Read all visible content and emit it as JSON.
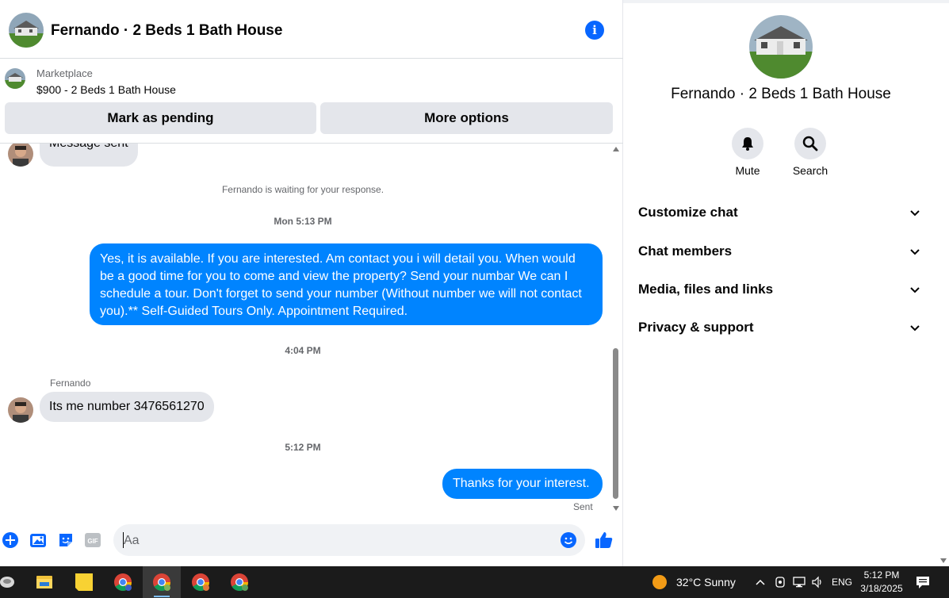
{
  "header": {
    "title": "Fernando · 2 Beds 1 Bath House"
  },
  "marketplace": {
    "label": "Marketplace",
    "listing": "$900 - 2 Beds 1 Bath House",
    "pending_label": "Mark as pending",
    "more_label": "More options"
  },
  "messages": {
    "partial_text": "Message sent",
    "waiting_note": "Fernando is waiting for your response.",
    "time1": "Mon 5:13 PM",
    "outgoing1": "Yes, it is available. If you are interested.  Am contact you i will detail you.  When would be a good time for you to come and view the property? Send your numbar We can I schedule a tour.  Don't forget to send your number (Without number we will not contact you).** Self-Guided Tours Only. Appointment Required.",
    "time2": "4:04 PM",
    "sender": "Fernando",
    "incoming1": "Its me number  3476561270",
    "time3": "5:12 PM",
    "outgoing2": "Thanks for your interest.",
    "sent_status": "Sent"
  },
  "composer": {
    "placeholder": "Aa"
  },
  "details": {
    "title": "Fernando · 2 Beds 1 Bath House",
    "mute_label": "Mute",
    "search_label": "Search",
    "sections": [
      {
        "label": "Customize chat"
      },
      {
        "label": "Chat members"
      },
      {
        "label": "Media, files and links"
      },
      {
        "label": "Privacy & support"
      }
    ]
  },
  "taskbar": {
    "weather": "32°C  Sunny",
    "lang": "ENG",
    "time": "5:12 PM",
    "date": "3/18/2025"
  },
  "colors": {
    "accent": "#0084ff",
    "brand_blue": "#0866ff",
    "bubble_in": "#e4e6eb",
    "taskbar": "#1b1b1b"
  }
}
